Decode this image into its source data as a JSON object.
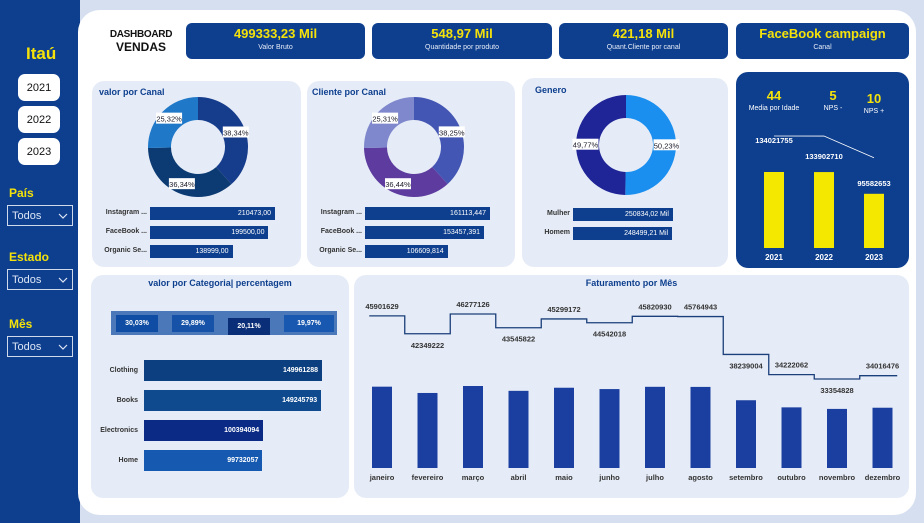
{
  "sidebar": {
    "brand": "Itaú",
    "years": [
      "2021",
      "2022",
      "2023"
    ],
    "filters": [
      {
        "label": "País",
        "value": "Todos"
      },
      {
        "label": "Estado",
        "value": "Todos"
      },
      {
        "label": "Mês",
        "value": "Todos"
      }
    ]
  },
  "header": {
    "title_line1": "DASHBOARD",
    "title_line2": "VENDAS"
  },
  "kpis": [
    {
      "value": "499333,23 Mil",
      "label": "Valor Bruto"
    },
    {
      "value": "548,97 Mil",
      "label": "Quantidade por produto"
    },
    {
      "value": "421,18 Mil",
      "label": "Quant.Cliente por canal"
    },
    {
      "value": "FaceBook campaign",
      "label": "Canal"
    }
  ],
  "colors": {
    "primary": "#0e3f8e",
    "accent": "#f4e20a",
    "panel": "#e6ecf7"
  },
  "chart_data": [
    {
      "type": "pie",
      "title": "valor por Canal",
      "slices": [
        {
          "label": "38,34%",
          "value": 38.34,
          "color": "#163c8c"
        },
        {
          "label": "36,34%",
          "value": 36.34,
          "color": "#0c3b73"
        },
        {
          "label": "25,32%",
          "value": 25.32,
          "color": "#1f78c8"
        }
      ],
      "bars": {
        "categories": [
          "Instagram ...",
          "FaceBook ...",
          "Organic Se..."
        ],
        "values": [
          210473.0,
          199500.0,
          138999.0
        ],
        "labels": [
          "210473,00",
          "199500,00",
          "138999,00"
        ]
      }
    },
    {
      "type": "pie",
      "title": "Cliente  por Canal",
      "slices": [
        {
          "label": "38,25%",
          "value": 38.25,
          "color": "#4456b4"
        },
        {
          "label": "36,44%",
          "value": 36.44,
          "color": "#5d3b9f"
        },
        {
          "label": "25,31%",
          "value": 25.31,
          "color": "#7f88cc"
        }
      ],
      "bars": {
        "categories": [
          "Instagram ...",
          "FaceBook ...",
          "Organic Se..."
        ],
        "values": [
          161113.447,
          153457.391,
          106609.814
        ],
        "labels": [
          "161113,447",
          "153457,391",
          "106609,814"
        ]
      }
    },
    {
      "type": "pie",
      "title": "Genero",
      "slices": [
        {
          "label": "50,23%",
          "value": 50.23,
          "color": "#1a8fef"
        },
        {
          "label": "49,77%",
          "value": 49.77,
          "color": "#1f2596"
        }
      ],
      "bars": {
        "categories": [
          "Mulher",
          "Homem"
        ],
        "values": [
          250834.02,
          248499.21
        ],
        "labels": [
          "250834,02 Mil",
          "248499,21 Mil"
        ]
      }
    },
    {
      "type": "bar",
      "title": "",
      "top_kpis": [
        {
          "value": "44",
          "label": "Media por Idade"
        },
        {
          "value": "5",
          "label": "NPS -"
        },
        {
          "value": "10",
          "label": "NPS +"
        }
      ],
      "categories": [
        "2021",
        "2022",
        "2023"
      ],
      "values": [
        134021755,
        133902710,
        95582653
      ],
      "labels": [
        "134021755",
        "133902710",
        "95582653"
      ],
      "color": "#f4e800"
    },
    {
      "type": "bar",
      "title": "valor por Categoria| percentagem",
      "stacked_percent": [
        {
          "label": "30,03%",
          "value": 30.03,
          "color": "#0e4da3"
        },
        {
          "label": "29,89%",
          "value": 29.89,
          "color": "#1653a8"
        },
        {
          "label": "20,11%",
          "value": 20.11,
          "color": "#0a2f78"
        },
        {
          "label": "19,97%",
          "value": 19.97,
          "color": "#1858b0"
        }
      ],
      "categories": [
        "Clothing",
        "Books",
        "Electronics",
        "Home"
      ],
      "values": [
        149961288,
        149245793,
        100394094,
        99732057
      ],
      "labels": [
        "149961288",
        "149245793",
        "100394094",
        "99732057"
      ],
      "colors": [
        "#0c3f7f",
        "#0f4a8f",
        "#0a2a86",
        "#1559b0"
      ]
    },
    {
      "type": "bar",
      "title": "Faturamento por Mês",
      "categories": [
        "janeiro",
        "fevereiro",
        "março",
        "abril",
        "maio",
        "junho",
        "julho",
        "agosto",
        "setembro",
        "outubro",
        "novembro",
        "dezembro"
      ],
      "values": [
        45901629,
        42349222,
        46277126,
        43545822,
        45299172,
        44542018,
        45820930,
        45764943,
        38239004,
        34222062,
        33354828,
        34016476
      ],
      "labels": [
        "45901629",
        "42349222",
        "46277126",
        "43545822",
        "45299172",
        "44542018",
        "45820930",
        "45764943",
        "38239004",
        "34222062",
        "33354828",
        "34016476"
      ],
      "color": "#1a3fa0"
    }
  ]
}
